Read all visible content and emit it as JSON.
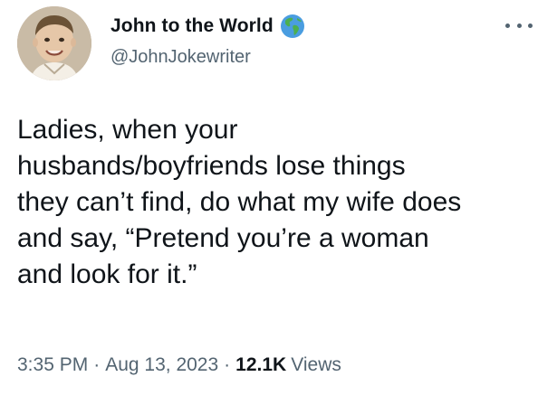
{
  "author": {
    "display_name": "John to the World",
    "handle": "@JohnJokewriter",
    "badge_icon": "globe-americas-icon",
    "avatar_icon": "child-photo-avatar"
  },
  "more_icon": "more-options-icon",
  "tweet": {
    "lines": [
      "Ladies, when your",
      "husbands/boyfriends lose things",
      "they can’t find, do what my wife does",
      "and say, “Pretend you’re a woman",
      "and look for it.”"
    ]
  },
  "meta": {
    "time": "3:35 PM",
    "separator": "·",
    "date": "Aug 13, 2023",
    "views_count": "12.1K",
    "views_label": "Views"
  },
  "colors": {
    "text": "#0f1419",
    "secondary": "#536471",
    "globe_ocean": "#4a9de0",
    "globe_land": "#4caf50"
  }
}
